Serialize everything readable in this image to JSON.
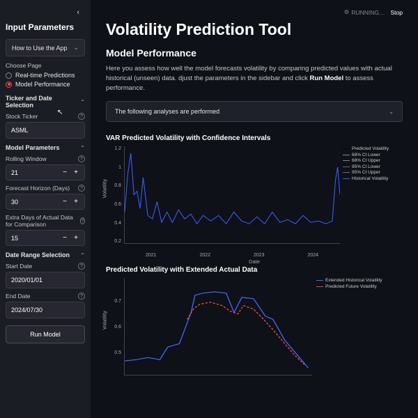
{
  "sidebar": {
    "heading": "Input Parameters",
    "howto": "How to Use the App",
    "choose_page": "Choose Page",
    "pages": [
      "Real-time Predictions",
      "Model Performance"
    ],
    "sec1": "Ticker and Date Selection",
    "stock_ticker_label": "Stock Ticker",
    "stock_ticker_value": "ASML",
    "sec2": "Model Parameters",
    "rw_label": "Rolling Window",
    "rw_value": "21",
    "fh_label": "Forecast Horizon (Days)",
    "fh_value": "30",
    "ed_label": "Extra Days of Actual Data for Comparison",
    "ed_value": "15",
    "sec3": "Date Range Selection",
    "start_label": "Start Date",
    "start_value": "2020/01/01",
    "end_label": "End Date",
    "end_value": "2024/07/30",
    "run": "Run Model"
  },
  "topbar": {
    "running": "RUNNING…",
    "stop": "Stop"
  },
  "main": {
    "title": "Volatility Prediction Tool",
    "h3": "Model Performance",
    "desc_pre": "Here you assess how well the model forecasts volatility by comparing predicted values with actual historical (unseen) data. djust the parameters in the sidebar and click ",
    "desc_bold": "Run Model",
    "desc_post": " to assess performance.",
    "expander": "The following analyses are performed"
  },
  "chart_data": [
    {
      "type": "line",
      "title": "VAR Predicted Volatility with Confidence Intervals",
      "ylabel": "Volatility",
      "xlabel": "Date",
      "yticks": [
        "0.2",
        "0.4",
        "0.6",
        "0.8",
        "1",
        "1.2"
      ],
      "xticks": [
        "2021",
        "2022",
        "2023",
        "2024"
      ],
      "ylim": [
        0,
        1.3
      ],
      "legend": [
        "Predicted Volatility",
        "68% CI Lower",
        "68% CI Upper",
        "95% CI Lower",
        "95% CI Upper",
        "Historical Volatility"
      ],
      "legend_colors": [
        "#000",
        "#888",
        "#888",
        "#6a6a6a",
        "#6a6a6a",
        "#3b5bff"
      ],
      "legend_style": [
        "dashed",
        "solid",
        "solid",
        "solid",
        "solid",
        "solid"
      ]
    },
    {
      "type": "line",
      "title": "Predicted Volatility with Extended Actual Data",
      "ylabel": "Volatility",
      "xlabel": "",
      "yticks": [
        "0.5",
        "0.6",
        "0.7"
      ],
      "ylim": [
        0.4,
        0.8
      ],
      "legend": [
        "Extended Historical Volatility",
        "Predicted Future Volatility"
      ],
      "legend_colors": [
        "#4169ff",
        "#ff4b4b"
      ],
      "legend_style": [
        "solid",
        "dashed"
      ]
    }
  ]
}
